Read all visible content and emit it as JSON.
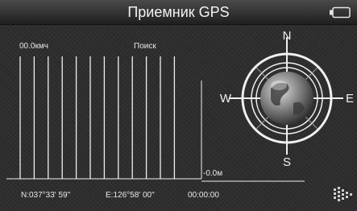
{
  "header": {
    "title": "Приемник GPS",
    "battery_icon": "battery-icon"
  },
  "readout": {
    "speed": "00.0кмч",
    "status": "Поиск",
    "altitude": "-0.0м"
  },
  "satellites": {
    "bar_count": 12,
    "signal_levels": [
      0,
      0,
      0,
      0,
      0,
      0,
      0,
      0,
      0,
      0,
      0,
      0
    ]
  },
  "compass": {
    "north": "N",
    "south": "S",
    "west": "W",
    "east": "E",
    "icon": "compass-icon",
    "globe_icon": "globe-icon"
  },
  "footer": {
    "latitude": "N:037°33' 59\"",
    "longitude": "E:126°58' 00\"",
    "time": "00:00:00",
    "next_icon": "next-arrow-icon"
  },
  "colors": {
    "background": "#2e2e2e",
    "text": "#e6e6e6",
    "lines": "#f0f0f0"
  }
}
